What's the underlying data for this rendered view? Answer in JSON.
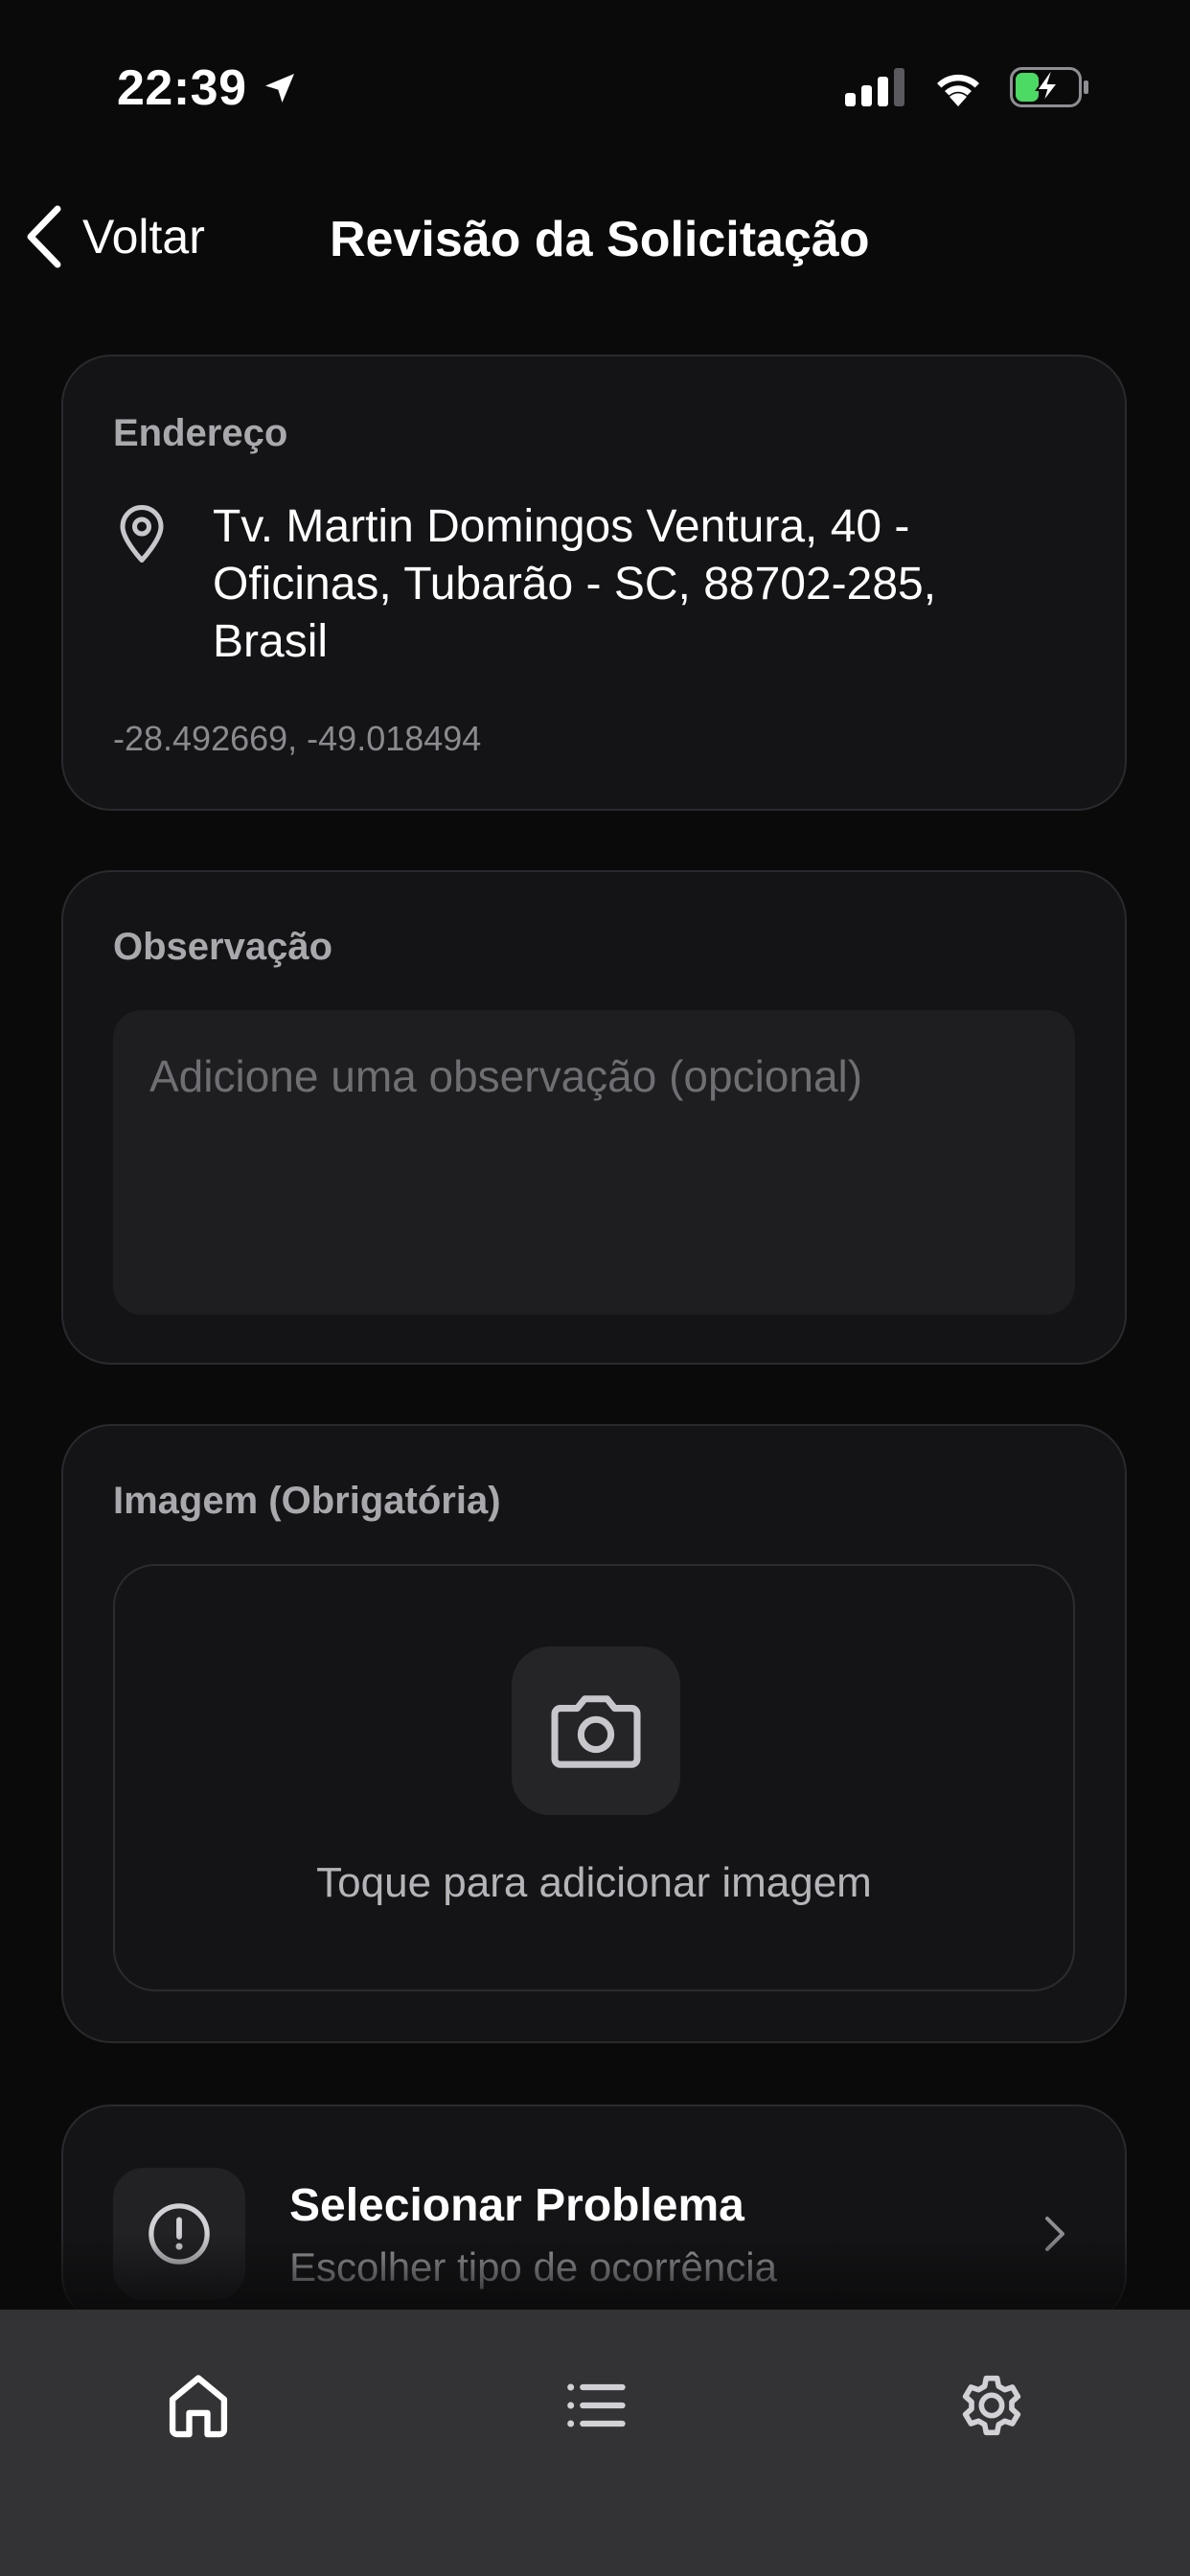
{
  "status_bar": {
    "time": "22:39",
    "location_icon": "location-arrow-icon",
    "signal_icon": "cellular-signal-icon",
    "wifi_icon": "wifi-icon",
    "battery_icon": "battery-charging-icon",
    "battery_color": "#4cd964"
  },
  "nav": {
    "back_label": "Voltar",
    "title": "Revisão da Solicitação"
  },
  "address": {
    "label": "Endereço",
    "text": "Tv. Martin Domingos Ventura, 40 - Oficinas, Tubarão - SC, 88702-285, Brasil",
    "coords": "-28.492669, -49.018494",
    "icon": "map-pin-icon"
  },
  "observation": {
    "label": "Observação",
    "value": "",
    "placeholder": "Adicione uma observação (opcional)"
  },
  "image": {
    "label": "Imagem (Obrigatória)",
    "hint": "Toque para adicionar imagem",
    "icon": "camera-icon"
  },
  "problem": {
    "title": "Selecionar Problema",
    "subtitle": "Escolher tipo de ocorrência",
    "icon": "alert-circle-icon"
  },
  "tab_bar": {
    "items": [
      {
        "name": "home",
        "icon": "home-icon",
        "active": true
      },
      {
        "name": "list",
        "icon": "list-icon",
        "active": false
      },
      {
        "name": "settings",
        "icon": "gear-icon",
        "active": false
      }
    ]
  },
  "colors": {
    "background": "#0a0a0b",
    "card": "#141416",
    "card_border": "#2a2a2e",
    "tab_bar": "#333336",
    "text_primary": "#ffffff",
    "text_secondary": "#a8a8ad"
  }
}
